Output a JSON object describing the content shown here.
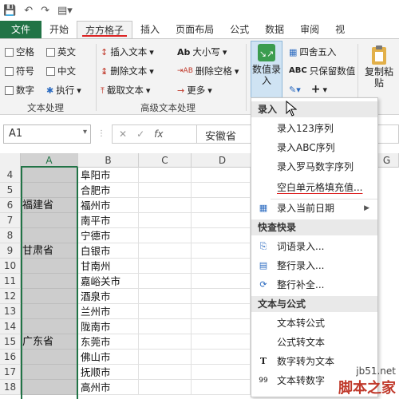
{
  "tabs": [
    {
      "label": "文件"
    },
    {
      "label": "开始"
    },
    {
      "label": "方方格子"
    },
    {
      "label": "插入"
    },
    {
      "label": "页面布局"
    },
    {
      "label": "公式"
    },
    {
      "label": "数据"
    },
    {
      "label": "审阅"
    },
    {
      "label": "视"
    }
  ],
  "ribbon": {
    "text_group": {
      "items": [
        "空格",
        "英文",
        "符号",
        "中文",
        "数字",
        "执行"
      ],
      "label": "文本处理"
    },
    "advanced_group": {
      "items": [
        "插入文本",
        "大小写",
        "删除文本",
        "删除空格",
        "截取文本",
        "更多"
      ],
      "label": "高级文本处理"
    },
    "value_entry": {
      "line1": "数值录",
      "line2": "入"
    },
    "round": "四舍五入",
    "keep_value": "只保留数值",
    "copy_paste": {
      "line1": "复制粘",
      "line2": "贴"
    }
  },
  "formula_bar": {
    "name_box": "A1",
    "formula": "安徽省"
  },
  "columns": [
    "A",
    "B",
    "C",
    "D",
    "G"
  ],
  "rows": [
    {
      "num": "4",
      "b": "阜阳市"
    },
    {
      "num": "5",
      "b": "合肥市"
    },
    {
      "num": "6",
      "b": "福州市"
    },
    {
      "num": "7",
      "b": "南平市"
    },
    {
      "num": "8",
      "b": "宁德市"
    },
    {
      "num": "9",
      "b": "白银市"
    },
    {
      "num": "10",
      "b": "甘南州"
    },
    {
      "num": "11",
      "b": "嘉峪关市"
    },
    {
      "num": "12",
      "b": "酒泉市"
    },
    {
      "num": "13",
      "b": "兰州市"
    },
    {
      "num": "14",
      "b": "陇南市"
    },
    {
      "num": "15",
      "b": "东莞市"
    },
    {
      "num": "16",
      "b": "佛山市"
    },
    {
      "num": "17",
      "b": "抚顺市"
    },
    {
      "num": "18",
      "b": "高州市"
    }
  ],
  "a_labels": [
    "福建省",
    "甘肃省",
    "广东省"
  ],
  "menu": {
    "sections": [
      "录入",
      "快查快录",
      "文本与公式"
    ],
    "items": [
      {
        "label": "录入123序列"
      },
      {
        "label": "录入ABC序列"
      },
      {
        "label": "录入罗马数字序列"
      },
      {
        "label": "空白单元格填充值..."
      },
      {
        "label": "录入当前日期"
      },
      {
        "label": "词语录入..."
      },
      {
        "label": "整行录入..."
      },
      {
        "label": "整行补全..."
      },
      {
        "label": "文本转公式"
      },
      {
        "label": "公式转文本"
      },
      {
        "label": "数字转为文本"
      },
      {
        "label": "文本转数字"
      }
    ]
  },
  "watermark": {
    "url": "jb51.net",
    "name": "脚本之家"
  }
}
